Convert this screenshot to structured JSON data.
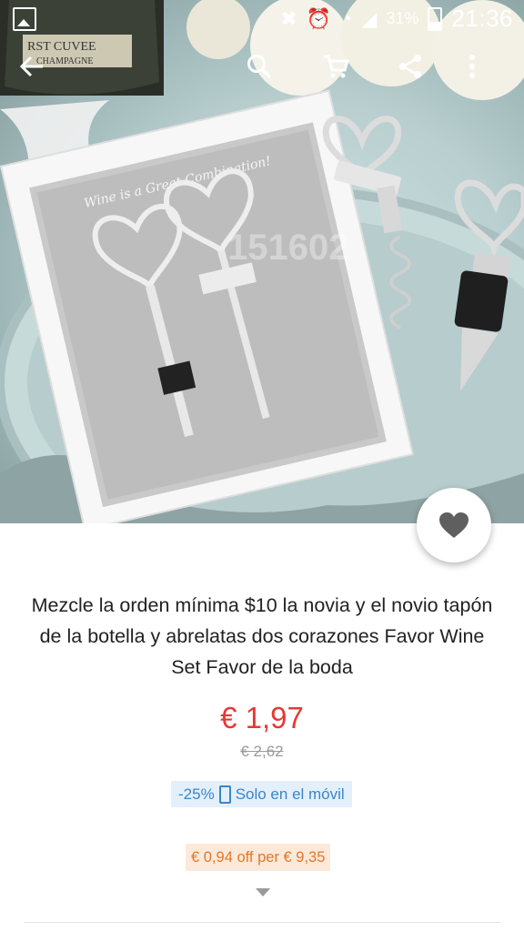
{
  "status_bar": {
    "battery_percent": "31%",
    "time": "21:36",
    "icons": [
      "gallery-icon",
      "mute-icon",
      "alarm-icon",
      "wifi-icon",
      "signal-icon",
      "battery-icon"
    ]
  },
  "toolbar": {
    "icons": [
      "back-arrow-icon",
      "search-icon",
      "cart-icon",
      "share-icon",
      "more-vert-icon"
    ]
  },
  "hero": {
    "image_alt": "Heart corkscrew and stopper wedding favor set",
    "box_script": "Wine is a Great Combination!",
    "bottle_label_1": "RST CUVEE",
    "bottle_label_2": "CHAMPAGNE",
    "watermark": "151602"
  },
  "product": {
    "title": "Mezcle la orden mínima $10 la novia y el novio tapón de la botella y abrelatas dos corazones Favor Wine Set Favor de la boda",
    "price": "€ 1,97",
    "old_price": "€ 2,62",
    "discount": "-25%",
    "mobile_only": "Solo en el móvil",
    "coupon": "€ 0,94 off per € 9,35"
  },
  "colors": {
    "price": "#e53935",
    "mobile_badge_bg": "#e3f0fb",
    "mobile_badge_text": "#3a86c8",
    "coupon_bg": "#fde9d9",
    "coupon_text": "#e0782c"
  }
}
